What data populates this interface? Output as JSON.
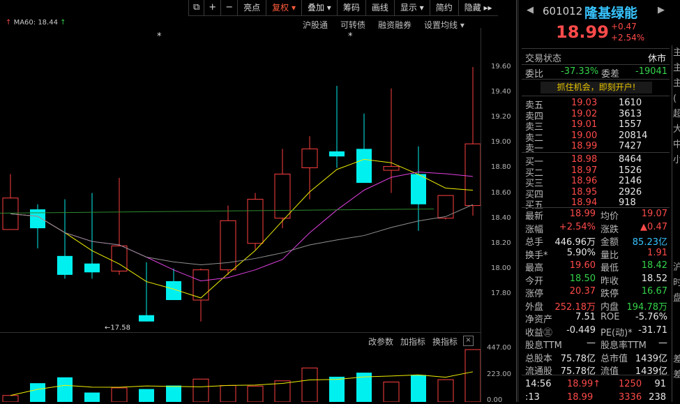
{
  "toolbar": {
    "icons": [
      "square-icon",
      "plus-icon",
      "minus-icon"
    ],
    "items": [
      {
        "label": "亮点",
        "active": false
      },
      {
        "label": "复权 ▾",
        "active": true
      },
      {
        "label": "叠加 ▾",
        "active": false
      },
      {
        "label": "筹码",
        "active": false
      },
      {
        "label": "画线",
        "active": false
      },
      {
        "label": "显示 ▾",
        "active": false
      },
      {
        "label": "简约",
        "active": false
      },
      {
        "label": "隐藏 ▸▸",
        "active": false
      }
    ]
  },
  "ma_legend": {
    "text": "MA60: 18.44",
    "arrow": "↑"
  },
  "top_links": [
    "沪股通",
    "可转债",
    "融资融券",
    "设置均线 ▾"
  ],
  "sub_links": [
    "改参数",
    "加指标",
    "换指标"
  ],
  "close_icon": "×",
  "markers": [
    "*",
    "*"
  ],
  "price_axis": [
    "19.60",
    "19.40",
    "19.20",
    "19.00",
    "18.80",
    "18.60",
    "18.40",
    "18.20",
    "18.00",
    "17.80"
  ],
  "volume_axis": [
    "447.00",
    "223.00",
    "0.00"
  ],
  "low_annotation": "←17.58",
  "chart_data": {
    "type": "candlestick",
    "candles": [
      {
        "o": 18.31,
        "h": 18.75,
        "l": 18.55,
        "c": 18.56
      },
      {
        "o": 18.47,
        "h": 18.51,
        "l": 18.16,
        "c": 18.32
      },
      {
        "o": 18.1,
        "h": 18.55,
        "l": 17.92,
        "c": 17.95
      },
      {
        "o": 18.04,
        "h": 18.6,
        "l": 17.92,
        "c": 17.97
      },
      {
        "o": 17.98,
        "h": 18.72,
        "l": 17.95,
        "c": 18.18
      },
      {
        "o": 17.63,
        "h": 18.05,
        "l": 17.58,
        "c": 17.58
      },
      {
        "o": 17.9,
        "h": 18.0,
        "l": 17.78,
        "c": 17.75
      },
      {
        "o": 17.75,
        "h": 18.0,
        "l": 17.58,
        "c": 17.99
      },
      {
        "o": 17.99,
        "h": 18.5,
        "l": 17.95,
        "c": 18.38
      },
      {
        "o": 18.2,
        "h": 18.6,
        "l": 18.15,
        "c": 18.55
      },
      {
        "o": 18.4,
        "h": 18.95,
        "l": 18.32,
        "c": 18.75
      },
      {
        "o": 18.8,
        "h": 19.05,
        "l": 18.55,
        "c": 18.95
      },
      {
        "o": 18.93,
        "h": 19.45,
        "l": 18.8,
        "c": 18.89
      },
      {
        "o": 18.95,
        "h": 19.23,
        "l": 18.75,
        "c": 18.68
      },
      {
        "o": 18.78,
        "h": 19.43,
        "l": 18.6,
        "c": 18.81
      },
      {
        "o": 18.75,
        "h": 18.97,
        "l": 18.3,
        "c": 18.51
      },
      {
        "o": 18.4,
        "h": 18.58,
        "l": 18.39,
        "c": 18.58
      },
      {
        "o": 18.5,
        "h": 19.6,
        "l": 18.42,
        "c": 18.99
      }
    ],
    "volumes": [
      55,
      160,
      210,
      80,
      120,
      110,
      140,
      195,
      140,
      135,
      180,
      290,
      215,
      250,
      170,
      230,
      190,
      447
    ],
    "ma60": 18.44
  },
  "stock": {
    "code": "601012",
    "name": "隆基绿能",
    "price": "18.99",
    "change": "+0.47",
    "change_pct": "+2.54%"
  },
  "status": {
    "label": "交易状态",
    "value": "休市"
  },
  "weibi": {
    "label": "委比",
    "value": "-37.33%",
    "diff_label": "委差",
    "diff_value": "-19041"
  },
  "ad_text": "抓住机会，即刻开户!",
  "asks": [
    {
      "label": "卖五",
      "price": "19.03",
      "vol": "1610"
    },
    {
      "label": "卖四",
      "price": "19.02",
      "vol": "3613"
    },
    {
      "label": "卖三",
      "price": "19.01",
      "vol": "1557"
    },
    {
      "label": "卖二",
      "price": "19.00",
      "vol": "20814"
    },
    {
      "label": "卖一",
      "price": "18.99",
      "vol": "7427"
    }
  ],
  "bids": [
    {
      "label": "买一",
      "price": "18.98",
      "vol": "8464"
    },
    {
      "label": "买二",
      "price": "18.97",
      "vol": "1526"
    },
    {
      "label": "买三",
      "price": "18.96",
      "vol": "2146"
    },
    {
      "label": "买四",
      "price": "18.95",
      "vol": "2926"
    },
    {
      "label": "买五",
      "price": "18.94",
      "vol": "918"
    }
  ],
  "stats": [
    {
      "l1": "最新",
      "v1": "18.99",
      "c1": "r",
      "l2": "均价",
      "v2": "19.07",
      "c2": "r"
    },
    {
      "l1": "涨幅",
      "v1": "+2.54%",
      "c1": "r",
      "l2": "涨跌",
      "v2": "▲0.47",
      "c2": "r"
    },
    {
      "l1": "总手",
      "v1": "446.96万",
      "c1": "w",
      "l2": "金额",
      "v2": "85.23亿",
      "c2": "c"
    },
    {
      "l1": "换手*",
      "v1": "5.90%",
      "c1": "w",
      "l2": "量比",
      "v2": "1.91",
      "c2": "r"
    },
    {
      "l1": "最高",
      "v1": "19.60",
      "c1": "r",
      "l2": "最低",
      "v2": "18.42",
      "c2": "g"
    },
    {
      "l1": "今开",
      "v1": "18.50",
      "c1": "g",
      "l2": "昨收",
      "v2": "18.52",
      "c2": "w"
    },
    {
      "l1": "涨停",
      "v1": "20.37",
      "c1": "r",
      "l2": "跌停",
      "v2": "16.67",
      "c2": "g"
    },
    {
      "l1": "外盘",
      "v1": "252.18万",
      "c1": "r",
      "l2": "内盘",
      "v2": "194.78万",
      "c2": "g"
    },
    {
      "l1": "净资产",
      "v1": "7.51",
      "c1": "w",
      "l2": "ROE",
      "v2": "-5.76%",
      "c2": "w"
    },
    {
      "l1": "收益㊂",
      "v1": "-0.449",
      "c1": "w",
      "l2": "PE(动)*",
      "v2": "-31.71",
      "c2": "w"
    },
    {
      "l1": "股息TTM",
      "v1": "—",
      "c1": "w",
      "l2": "股息率TTM",
      "v2": "—",
      "c2": "w"
    },
    {
      "l1": "总股本",
      "v1": "75.78亿",
      "c1": "w",
      "l2": "总市值",
      "v2": "1439亿",
      "c2": "w"
    },
    {
      "l1": "流通股",
      "v1": "75.78亿",
      "c1": "w",
      "l2": "流值",
      "v2": "1439亿",
      "c2": "w"
    }
  ],
  "ticks": [
    {
      "time": "14:56",
      "price": "18.99↑",
      "vol": "1250",
      "num": "91"
    },
    {
      "time": ":13",
      "price": "18.99",
      "vol": "3336",
      "num": "238"
    }
  ],
  "edge_chars": [
    "主",
    "主",
    "主",
    "(",
    "超",
    "大",
    "中",
    "小",
    "",
    "",
    "",
    "",
    "",
    "",
    "沪",
    "时",
    "盘",
    "",
    "",
    "",
    "差",
    "差"
  ]
}
